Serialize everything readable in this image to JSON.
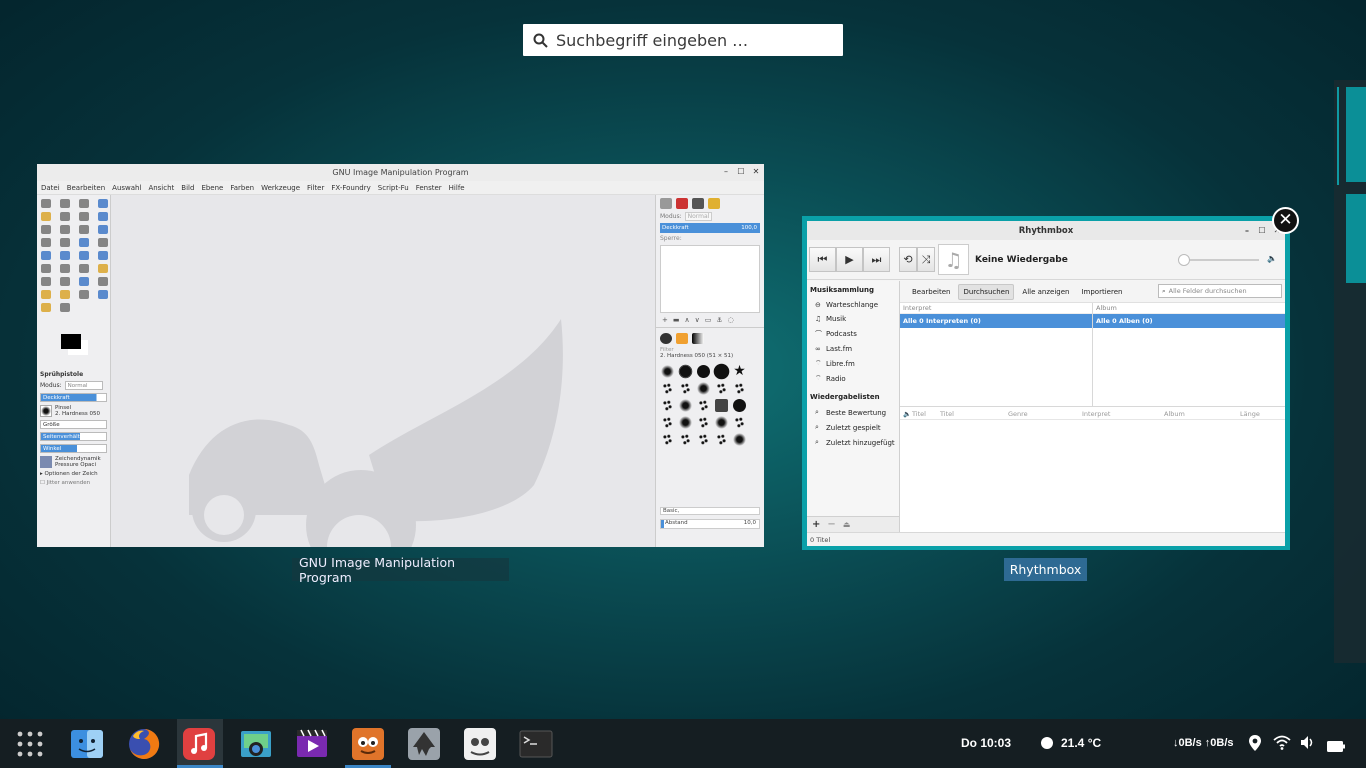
{
  "search": {
    "placeholder": "Suchbegriff eingeben …"
  },
  "gimp": {
    "title": "GNU Image Manipulation Program",
    "menu": [
      "Datei",
      "Bearbeiten",
      "Auswahl",
      "Ansicht",
      "Bild",
      "Ebene",
      "Farben",
      "Werkzeuge",
      "Filter",
      "FX-Foundry",
      "Script-Fu",
      "Fenster",
      "Hilfe"
    ],
    "tool_options": {
      "title": "Sprühpistole",
      "mode_label": "Modus:",
      "mode_value": "Normal",
      "opacity": "Deckkraft",
      "brush_label": "Pinsel",
      "brush_value": "2. Hardness 050",
      "size": "Größe",
      "aspect": "Seitenverhältnis",
      "angle": "Winkel",
      "dynamics_1": "Zeichendynamik",
      "dynamics_2": "Pressure Opaci",
      "dynamics_options": "Optionen der Zeich",
      "jitter": "Jitter anwenden"
    },
    "layers": {
      "mode_label": "Modus:",
      "mode_value": "Normal",
      "opacity_label": "Deckkraft",
      "opacity_value": "100,0",
      "lock_label": "Sperre:"
    },
    "brushes": {
      "filter": "Filter",
      "current": "2. Hardness 050 (51 × 51)",
      "tag": "Basic,",
      "spacing_label": "Abstand",
      "spacing_value": "10,0"
    }
  },
  "rhythmbox": {
    "title": "Rhythmbox",
    "now_playing": "Keine Wiedergabe",
    "sections": {
      "library": "Musiksammlung",
      "playlists": "Wiedergabelisten"
    },
    "library_items": [
      {
        "icon": "queue-icon",
        "label": "Warteschlange"
      },
      {
        "icon": "music-icon",
        "label": "Musik"
      },
      {
        "icon": "podcast-icon",
        "label": "Podcasts"
      },
      {
        "icon": "lastfm-icon",
        "label": "Last.fm"
      },
      {
        "icon": "librefm-icon",
        "label": "Libre.fm"
      },
      {
        "icon": "radio-icon",
        "label": "Radio"
      }
    ],
    "playlist_items": [
      {
        "icon": "playlist-icon",
        "label": "Beste Bewertung"
      },
      {
        "icon": "playlist-icon",
        "label": "Zuletzt gespielt"
      },
      {
        "icon": "playlist-icon",
        "label": "Zuletzt hinzugefügt"
      }
    ],
    "tabs": [
      "Bearbeiten",
      "Durchsuchen",
      "Alle anzeigen",
      "Importieren"
    ],
    "active_tab": "Durchsuchen",
    "filter_placeholder": "Alle Felder durchsuchen",
    "browser": {
      "artist_header": "Interpret",
      "artist_selected": "Alle 0 Interpreten (0)",
      "album_header": "Album",
      "album_selected": "Alle 0 Alben (0)"
    },
    "track_columns": [
      "Titel",
      "Titel",
      "Genre",
      "Interpret",
      "Album",
      "Länge"
    ],
    "status": "0 Titel"
  },
  "labels": {
    "gimp": "GNU Image Manipulation Program",
    "rhythmbox": "Rhythmbox"
  },
  "taskbar": {
    "apps": [
      {
        "name": "app-grid-icon"
      },
      {
        "name": "finder-icon"
      },
      {
        "name": "firefox-icon"
      },
      {
        "name": "music-player-icon"
      },
      {
        "name": "screenshot-icon"
      },
      {
        "name": "video-editor-icon"
      },
      {
        "name": "gimp-icon"
      },
      {
        "name": "inkscape-icon"
      },
      {
        "name": "gimp-alt-icon"
      },
      {
        "name": "terminal-icon"
      }
    ],
    "clock": "Do 10:03",
    "temperature": "21.4 °C",
    "network": "↓0B/s ↑0B/s"
  },
  "colors": {
    "accent": "#0aa0a8",
    "selection": "#4a90d9",
    "taskbar": "#151e22"
  }
}
